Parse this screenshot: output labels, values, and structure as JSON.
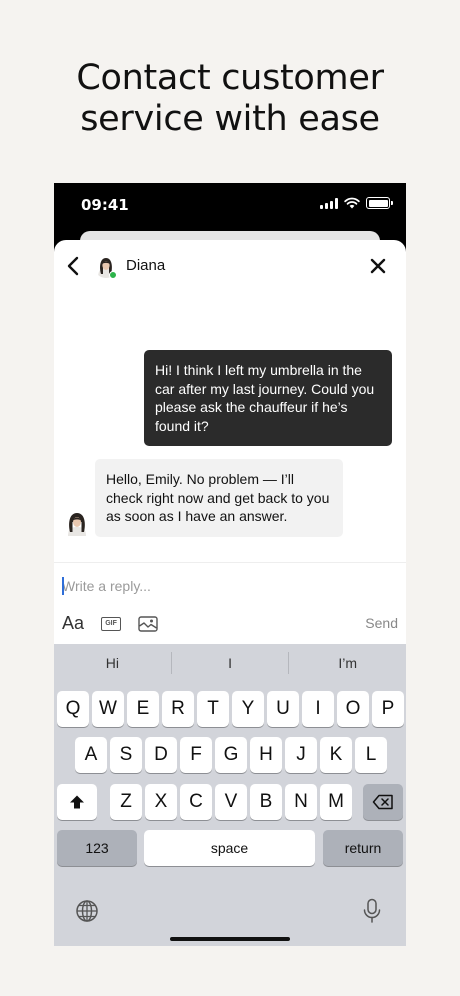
{
  "headline": {
    "line1": "Contact customer",
    "line2": "service with ease"
  },
  "status_bar": {
    "time": "09:41"
  },
  "chat": {
    "contact_name": "Diana",
    "messages": [
      {
        "from": "user",
        "text": "Hi! I think I left my umbrella in the car after my last journey. Could you please ask the chauffeur if he’s found it?"
      },
      {
        "from": "agent",
        "text": "Hello, Emily. No problem — I’ll check right now and get back to you as soon as I have an answer."
      }
    ]
  },
  "composer": {
    "placeholder": "Write a reply...",
    "format_label": "Aa",
    "gif_label": "GIF",
    "send_label": "Send"
  },
  "keyboard": {
    "suggestions": [
      "Hi",
      "I",
      "I’m"
    ],
    "row1": [
      "Q",
      "W",
      "E",
      "R",
      "T",
      "Y",
      "U",
      "I",
      "O",
      "P"
    ],
    "row2": [
      "A",
      "S",
      "D",
      "F",
      "G",
      "H",
      "J",
      "K",
      "L"
    ],
    "row3": [
      "Z",
      "X",
      "C",
      "V",
      "B",
      "N",
      "M"
    ],
    "numbers_label": "123",
    "space_label": "space",
    "return_label": "return"
  },
  "colors": {
    "online": "#2db34a",
    "outgoing_bubble": "#2b2b2b",
    "incoming_bubble": "#f2f2f2",
    "keyboard_bg": "#d2d4da"
  }
}
